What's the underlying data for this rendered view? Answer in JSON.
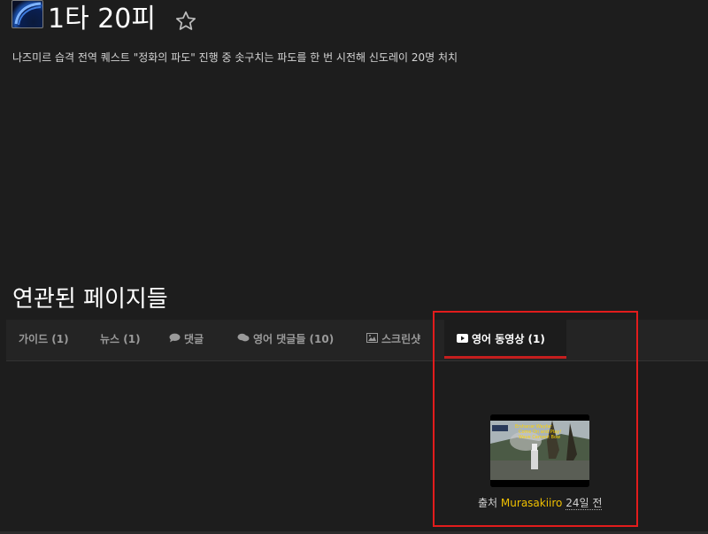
{
  "header": {
    "icon": "achievement-icon",
    "title": "1타 20피",
    "favorite_icon": "star-outline-icon",
    "description": "나즈미르 습격 전역 퀘스트 \"정화의 파도\" 진행 중 솟구치는 파도를 한 번 시전해 신도레이 20명 처치"
  },
  "related": {
    "heading": "연관된 페이지들",
    "tabs": [
      {
        "label": "가이드 (1)",
        "icon": ""
      },
      {
        "label": "뉴스 (1)",
        "icon": ""
      },
      {
        "label": "댓글",
        "icon": "comment-icon"
      },
      {
        "label": "영어 댓글들 (10)",
        "icon": "comment-icon"
      },
      {
        "label": "스크린샷",
        "icon": "image-icon"
      },
      {
        "label": "영어 동영상 (1)",
        "icon": "youtube-icon",
        "active": true
      }
    ]
  },
  "video": {
    "thumbnail_text": "Ershanar Wayfar Come On and Play! Wave Cement Bow",
    "credit_prefix": "출처",
    "author": "Murasakiiro",
    "age": "24일 전"
  },
  "colors": {
    "background": "#1d1d1d",
    "tabbar": "#242424",
    "active_underline": "#c41e1e",
    "author_link": "#f0c000",
    "annotation_box": "#e21c1c"
  }
}
